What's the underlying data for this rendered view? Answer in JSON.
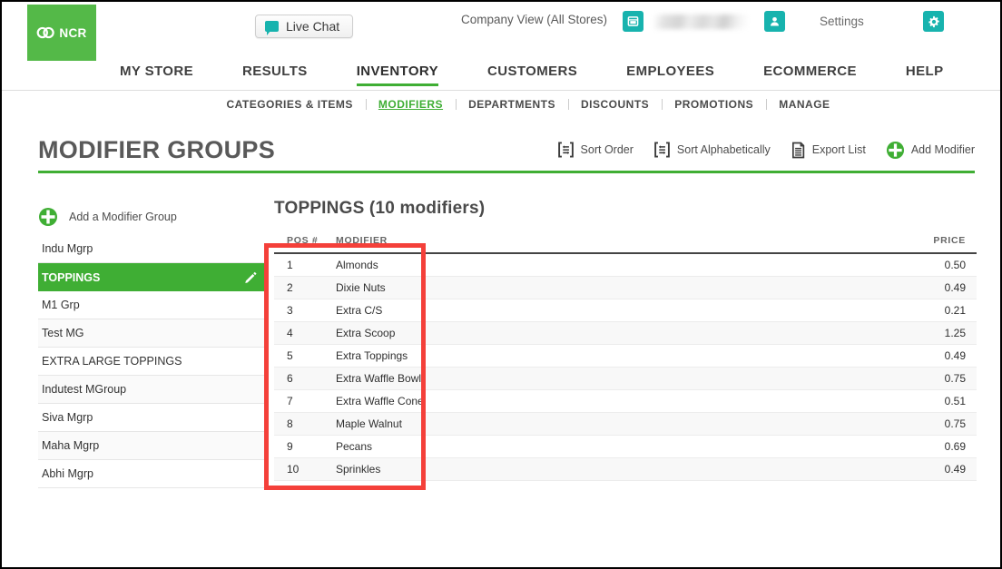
{
  "header": {
    "logo_text": "NCR",
    "logo_icon": "ncr-interlocking-circles-logo",
    "live_chat_label": "Live Chat",
    "live_chat_icon": "chat-bubble-icon",
    "company_view_label": "Company View (All Stores)",
    "store_icon": "store-icon",
    "user_icon": "user-icon",
    "user_name": "",
    "settings_label": "Settings",
    "gear_icon": "gear-icon"
  },
  "main_nav": [
    {
      "label": "MY STORE",
      "active": false
    },
    {
      "label": "RESULTS",
      "active": false
    },
    {
      "label": "INVENTORY",
      "active": true
    },
    {
      "label": "CUSTOMERS",
      "active": false
    },
    {
      "label": "EMPLOYEES",
      "active": false
    },
    {
      "label": "ECOMMERCE",
      "active": false
    },
    {
      "label": "HELP",
      "active": false
    }
  ],
  "sub_nav": [
    {
      "label": "CATEGORIES & ITEMS",
      "active": false
    },
    {
      "label": "MODIFIERS",
      "active": true
    },
    {
      "label": "DEPARTMENTS",
      "active": false
    },
    {
      "label": "DISCOUNTS",
      "active": false
    },
    {
      "label": "PROMOTIONS",
      "active": false
    },
    {
      "label": "MANAGE",
      "active": false
    }
  ],
  "page": {
    "title": "MODIFIER GROUPS"
  },
  "actions": [
    {
      "label": "Sort Order",
      "icon": "sort-order-icon"
    },
    {
      "label": "Sort Alphabetically",
      "icon": "sort-alphabetically-icon"
    },
    {
      "label": "Export List",
      "icon": "export-list-icon"
    },
    {
      "label": "Add Modifier",
      "icon": "add-plus-icon"
    }
  ],
  "sidebar": {
    "add_group_label": "Add a Modifier Group",
    "add_group_icon": "plus-circle-icon",
    "edit_icon": "pencil-icon",
    "items": [
      {
        "label": "Indu Mgrp",
        "selected": false
      },
      {
        "label": "TOPPINGS",
        "selected": true
      },
      {
        "label": "M1 Grp",
        "selected": false
      },
      {
        "label": "Test MG",
        "selected": false
      },
      {
        "label": "EXTRA LARGE TOPPINGS",
        "selected": false
      },
      {
        "label": "Indutest MGroup",
        "selected": false
      },
      {
        "label": "Siva Mgrp",
        "selected": false
      },
      {
        "label": "Maha Mgrp",
        "selected": false
      },
      {
        "label": "Abhi Mgrp",
        "selected": false
      }
    ]
  },
  "table": {
    "title": "TOPPINGS (10 modifiers)",
    "columns": [
      "POS #",
      "MODIFIER",
      "PRICE"
    ],
    "rows": [
      {
        "pos": "1",
        "modifier": "Almonds",
        "price": "0.50"
      },
      {
        "pos": "2",
        "modifier": "Dixie Nuts",
        "price": "0.49"
      },
      {
        "pos": "3",
        "modifier": "Extra C/S",
        "price": "0.21"
      },
      {
        "pos": "4",
        "modifier": "Extra Scoop",
        "price": "1.25"
      },
      {
        "pos": "5",
        "modifier": "Extra Toppings",
        "price": "0.49"
      },
      {
        "pos": "6",
        "modifier": "Extra Waffle Bowl",
        "price": "0.75"
      },
      {
        "pos": "7",
        "modifier": "Extra Waffle Cone",
        "price": "0.51"
      },
      {
        "pos": "8",
        "modifier": "Maple Walnut",
        "price": "0.75"
      },
      {
        "pos": "9",
        "modifier": "Pecans",
        "price": "0.69"
      },
      {
        "pos": "10",
        "modifier": "Sprinkles",
        "price": "0.49"
      }
    ]
  },
  "annotation": {
    "highlight_box_color": "#f4403a"
  },
  "colors": {
    "brand_green": "#54b948",
    "accent_green": "#3fae34",
    "teal": "#17b3ae",
    "title_gray": "#595959"
  }
}
